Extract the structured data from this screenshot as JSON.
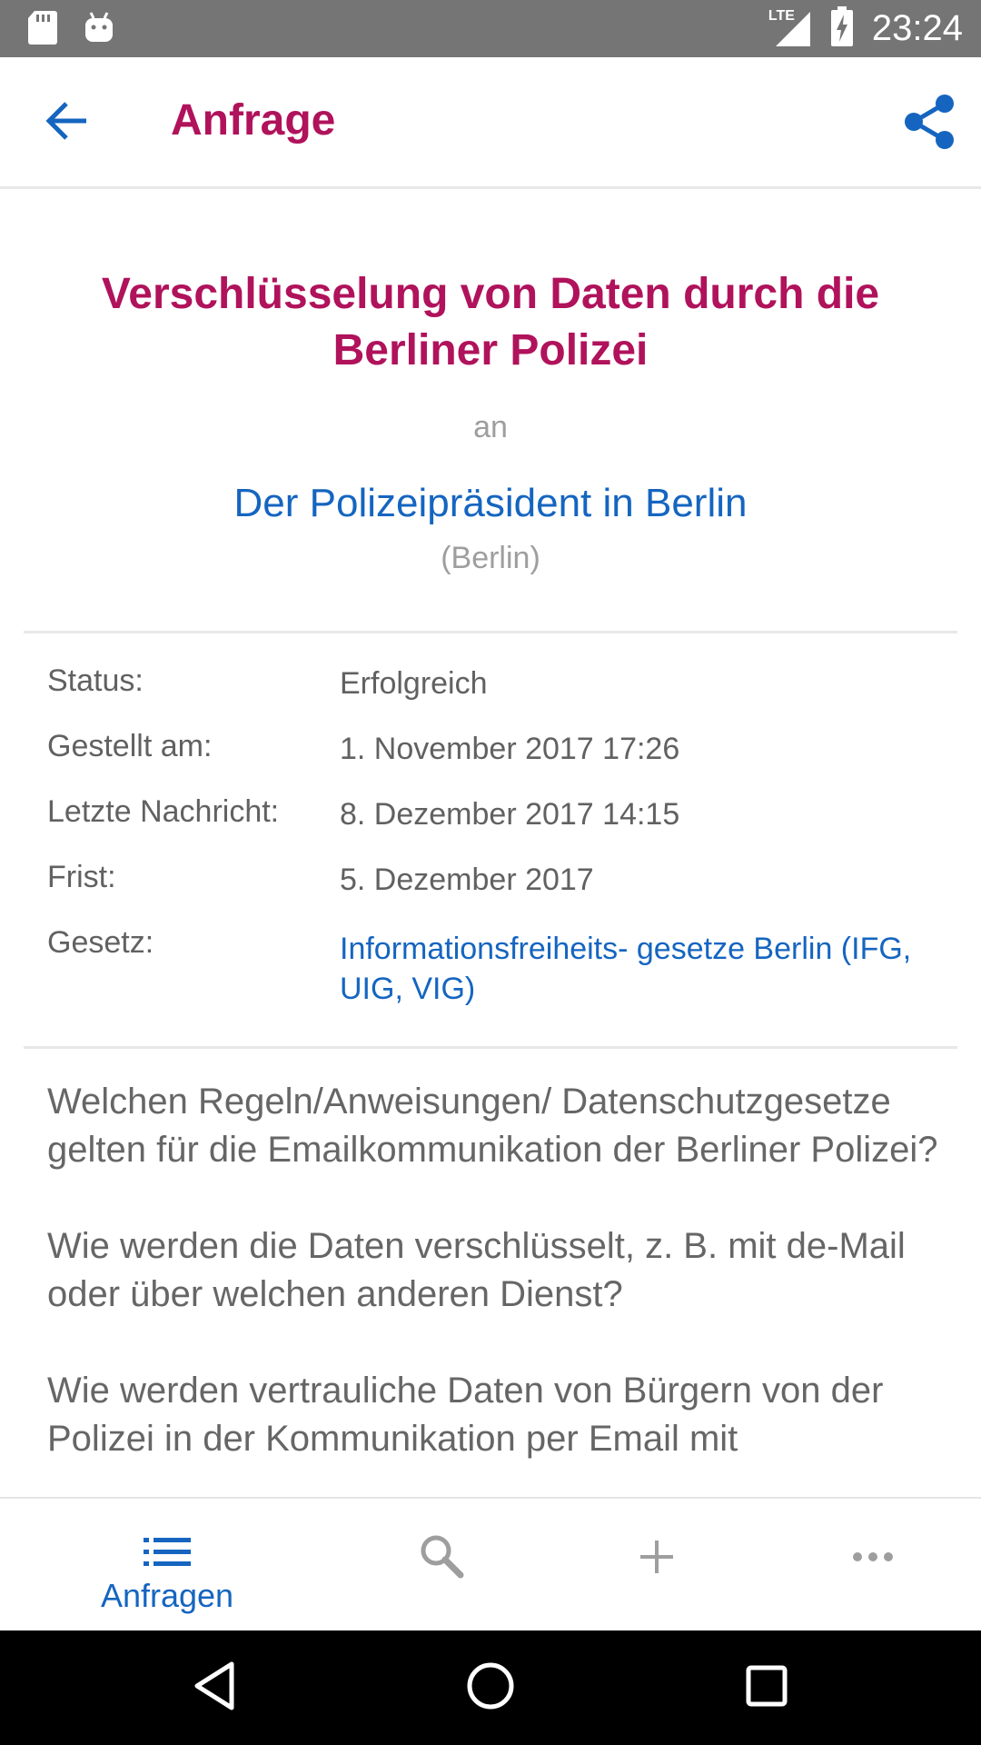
{
  "status_bar": {
    "time": "23:24",
    "network": "LTE",
    "icons": [
      "sd-card-icon",
      "android-icon",
      "lte-signal-icon",
      "battery-charging-icon"
    ]
  },
  "app_bar": {
    "title": "Anfrage",
    "back_icon": "arrow-back-icon",
    "share_icon": "share-icon"
  },
  "request": {
    "title": "Verschlüsselung von Daten durch die Berliner Polizei",
    "to_label": "an",
    "authority": "Der Polizeipräsident in Berlin",
    "jurisdiction": "(Berlin)"
  },
  "meta": [
    {
      "label": "Status:",
      "value": "Erfolgreich",
      "link": false
    },
    {
      "label": "Gestellt am:",
      "value": "1. November 2017 17:26",
      "link": false
    },
    {
      "label": "Letzte Nachricht:",
      "value": "8. Dezember 2017 14:15",
      "link": false
    },
    {
      "label": "Frist:",
      "value": "5. Dezember 2017",
      "link": false
    },
    {
      "label": "Gesetz:",
      "value": "Informationsfreiheits- gesetze Berlin (IFG, UIG, VIG)",
      "link": true
    }
  ],
  "description": [
    "Welchen Regeln/Anweisungen/ Datenschutzgesetze gelten für die Emailkommunikation der Berliner Polizei?",
    "Wie werden die Daten verschlüsselt, z. B. mit de-Mail oder über welchen anderen Dienst?",
    "Wie werden vertrauliche Daten von Bürgern von der Polizei in der Kommunikation per Email mit"
  ],
  "bottom_nav": {
    "items": [
      {
        "label": "Anfragen",
        "icon": "list-icon",
        "active": true
      },
      {
        "label": "",
        "icon": "search-icon",
        "active": false
      },
      {
        "label": "",
        "icon": "add-icon",
        "active": false
      },
      {
        "label": "",
        "icon": "more-horiz-icon",
        "active": false
      }
    ]
  },
  "colors": {
    "accent": "#b0125b",
    "link": "#1565c0",
    "text": "#616161",
    "muted": "#9e9e9e",
    "status_bar": "#757575"
  }
}
